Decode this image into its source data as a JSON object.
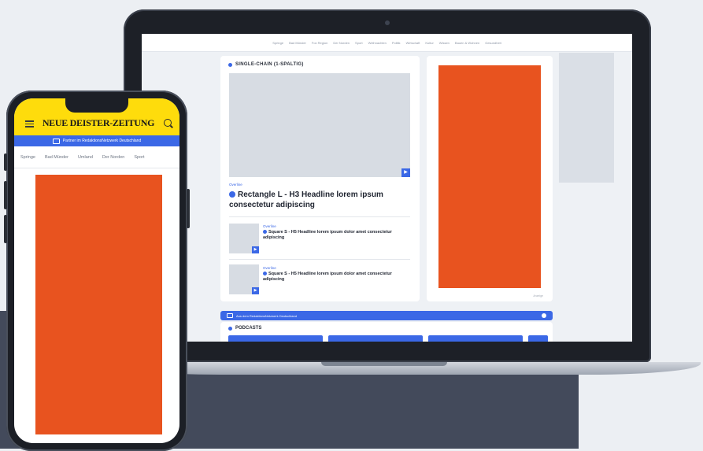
{
  "laptop": {
    "nav_items": [
      "Springe",
      "Bad Münder",
      "Fox Region",
      "Der Norden",
      "Sport",
      "Weihnachten",
      "Politik",
      "Wirtschaft",
      "Kultur",
      "Wissen",
      "Bauen & Wohnen",
      "Gesundheit"
    ],
    "section_title": "SINGLE-CHAIN (1-SPALTIG)",
    "main_overline": "Overline",
    "main_headline": "Rectangle L - H3 Headline lorem ipsum consectetur adipiscing",
    "small_items": [
      {
        "overline": "Overline",
        "headline": "Square S - H5 Headline lorem ipsum dolor amet consectetur adipiscing"
      },
      {
        "overline": "Overline",
        "headline": "Square S - H5 Headline lorem ipsum dolor amet consectetur adipiscing"
      }
    ],
    "ad_label": "Anzeige",
    "partner_bar": "Aus dem RedaktionsNetzwerk Deutschland",
    "podcasts_title": "PODCASTS"
  },
  "phone": {
    "logo": "NEUE DEISTER-ZEITUNG",
    "partner_text": "Partner im RedaktionsNetzwerk Deutschland",
    "nav_items": [
      "Springe",
      "Bad Münder",
      "Umland",
      "Der Norden",
      "Sport"
    ]
  },
  "colors": {
    "brand_yellow": "#fedc0c",
    "accent_blue": "#3b68e6",
    "ad_orange": "#e8531f"
  }
}
